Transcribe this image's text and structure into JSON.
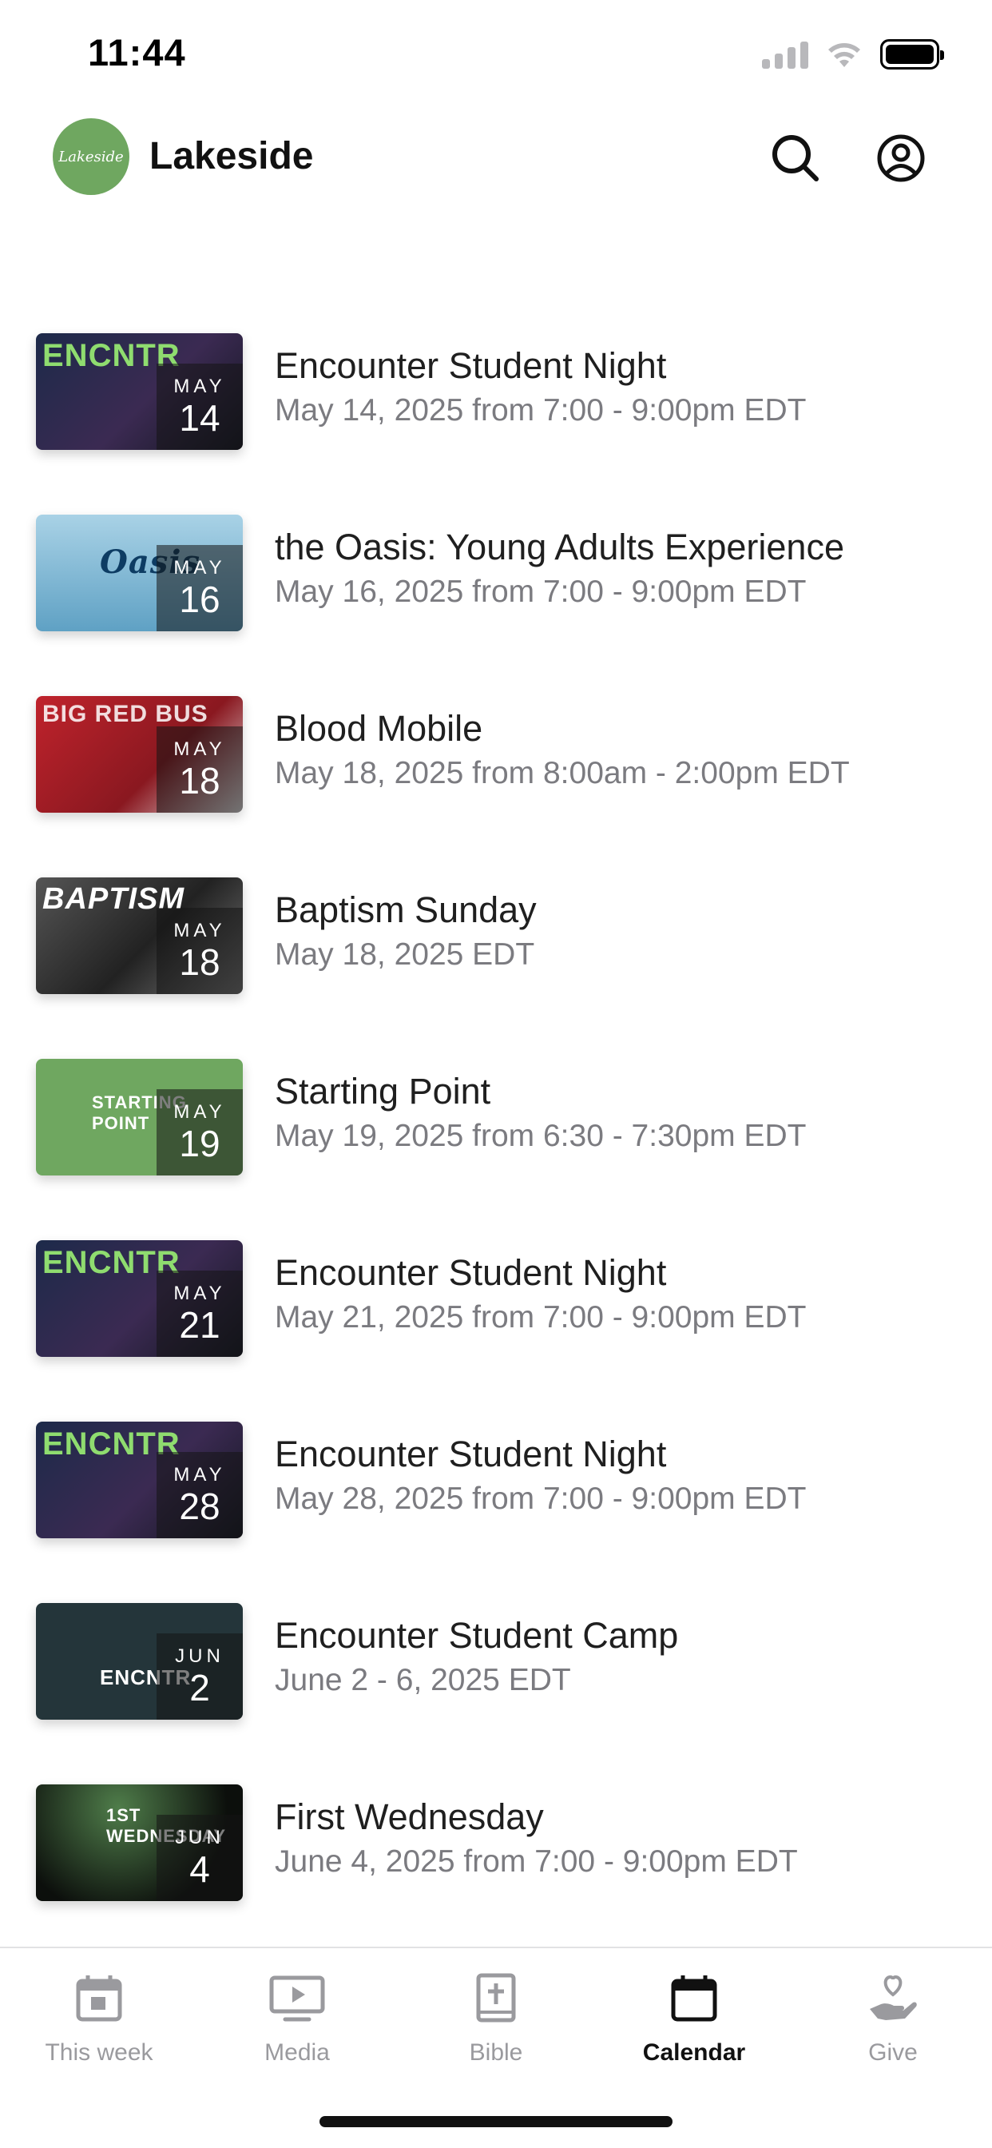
{
  "status_bar": {
    "time": "11:44"
  },
  "header": {
    "title": "Lakeside",
    "logo_text": "Lakeside"
  },
  "events": [
    {
      "title": "Encounter Student Night",
      "when": "May 14, 2025 from 7:00 - 9:00pm EDT",
      "month": "MAY",
      "day": "14",
      "art": "ENCNTR"
    },
    {
      "title": "the Oasis: Young Adults Experience",
      "when": "May 16, 2025 from 7:00 - 9:00pm EDT",
      "month": "MAY",
      "day": "16",
      "art": "Oasis"
    },
    {
      "title": "Blood Mobile",
      "when": "May 18, 2025 from 8:00am - 2:00pm EDT",
      "month": "MAY",
      "day": "18",
      "art": "BIG RED BUS"
    },
    {
      "title": "Baptism Sunday",
      "when": "May 18, 2025 EDT",
      "month": "MAY",
      "day": "18",
      "art": "BAPTISM"
    },
    {
      "title": "Starting Point",
      "when": "May 19, 2025 from 6:30 - 7:30pm EDT",
      "month": "MAY",
      "day": "19",
      "art": "STARTING POINT"
    },
    {
      "title": "Encounter Student Night",
      "when": "May 21, 2025 from 7:00 - 9:00pm EDT",
      "month": "MAY",
      "day": "21",
      "art": "ENCNTR"
    },
    {
      "title": "Encounter Student Night",
      "when": "May 28, 2025 from 7:00 - 9:00pm EDT",
      "month": "MAY",
      "day": "28",
      "art": "ENCNTR"
    },
    {
      "title": "Encounter Student Camp",
      "when": "June 2 - 6, 2025 EDT",
      "month": "JUN",
      "day": "2",
      "art": "ENCNTR"
    },
    {
      "title": "First Wednesday",
      "when": "June 4, 2025 from 7:00 - 9:00pm EDT",
      "month": "JUN",
      "day": "4",
      "art": "1ST WEDNESDAY"
    }
  ],
  "tabs": [
    {
      "label": "This week",
      "icon": "calendar-day-icon",
      "active": false
    },
    {
      "label": "Media",
      "icon": "play-screen-icon",
      "active": false
    },
    {
      "label": "Bible",
      "icon": "bible-icon",
      "active": false
    },
    {
      "label": "Calendar",
      "icon": "calendar-icon",
      "active": true
    },
    {
      "label": "Give",
      "icon": "give-hand-heart-icon",
      "active": false
    }
  ],
  "colors": {
    "accent_green": "#6fa760",
    "text_primary": "#1f1f1f",
    "text_secondary": "#7b7b80",
    "tab_inactive": "#9a9a9e"
  }
}
